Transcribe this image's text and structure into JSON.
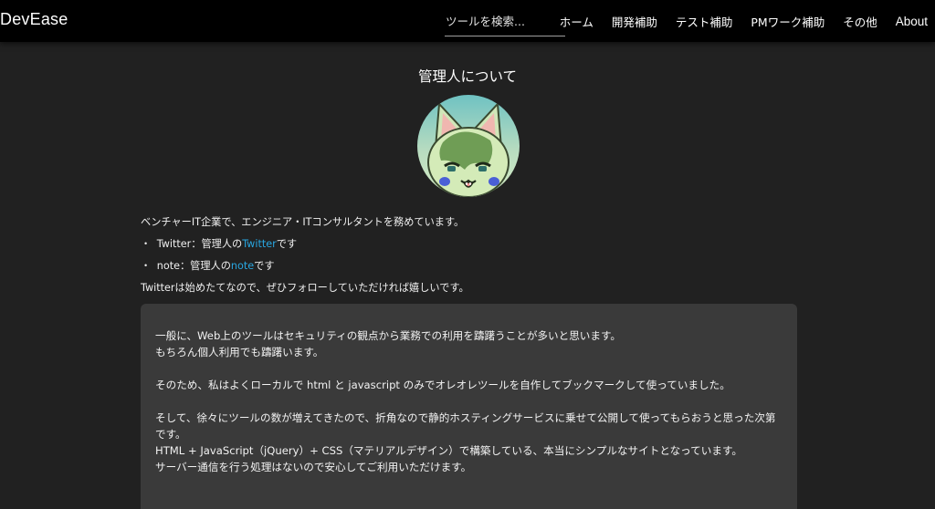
{
  "brand": "DevEase",
  "search": {
    "placeholder": "ツールを検索..."
  },
  "nav": {
    "home": "ホーム",
    "dev": "開発補助",
    "test": "テスト補助",
    "pm": "PMワーク補助",
    "other": "その他",
    "about": "About"
  },
  "page_title": "管理人について",
  "intro": {
    "line1": "ベンチャーIT企業で、エンジニア・ITコンサルタントを務めています。",
    "bullet": "・",
    "twitter_prefix": "Twitter：管理人の",
    "twitter_link": "Twitter",
    "twitter_suffix": "です",
    "note_prefix": "note：管理人の",
    "note_link": "note",
    "note_suffix": "です",
    "line4": "Twitterは始めたてなので、ぜひフォローしていただければ嬉しいです。"
  },
  "notice": {
    "p1_l1": "一般に、Web上のツールはセキュリティの観点から業務での利用を躊躇うことが多いと思います。",
    "p1_l2": "もちろん個人利用でも躊躇います。",
    "p2": "そのため、私はよくローカルで html と javascript のみでオレオレツールを自作してブックマークして使っていました。",
    "p3_l1": "そして、徐々にツールの数が増えてきたので、折角なので静的ホスティングサービスに乗せて公開して使ってもらおうと思った次第です。",
    "p3_l2": "HTML + JavaScript（jQuery）+ CSS（マテリアルデザイン）で構築している、本当にシンプルなサイトとなっています。",
    "p3_l3": "サーバー通信を行う処理はないので安心してご利用いただけます。"
  },
  "colors": {
    "background": "#212121",
    "navbar": "#000000",
    "link": "#29a7e1",
    "box": "#3a3a3a"
  }
}
